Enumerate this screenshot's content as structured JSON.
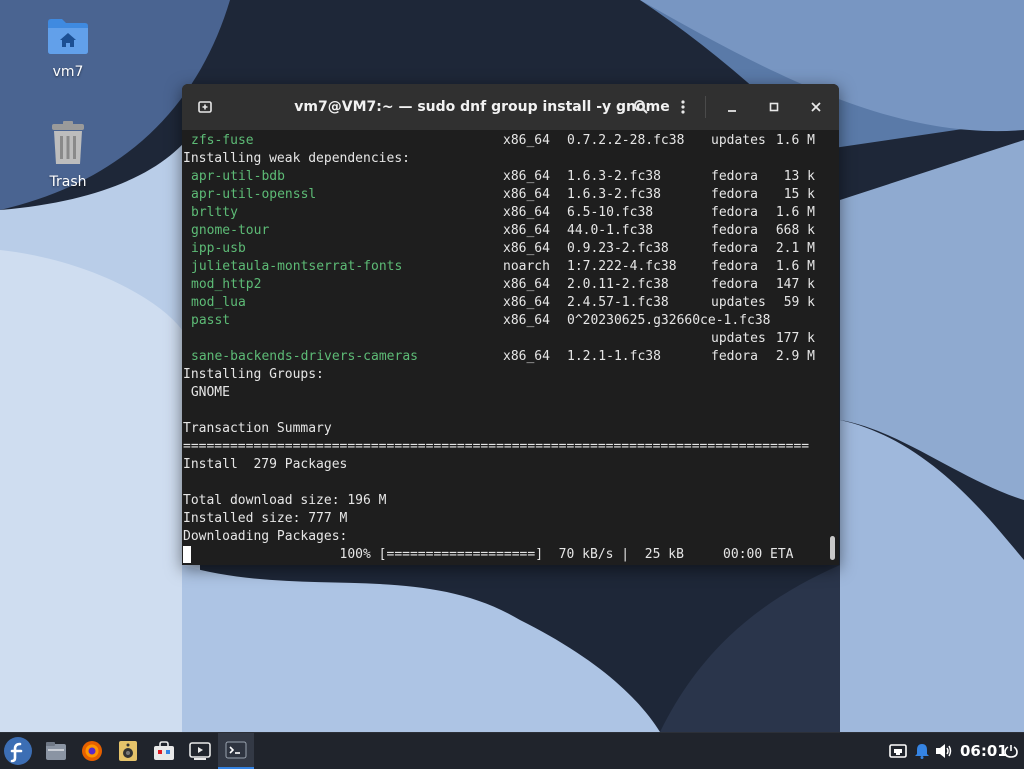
{
  "desktop": {
    "icons": [
      {
        "label": "vm7",
        "icon": "home-folder-icon"
      },
      {
        "label": "Trash",
        "icon": "trash-icon"
      }
    ]
  },
  "terminal": {
    "title": "vm7@VM7:~ — sudo dnf group install -y gnome",
    "lines": [
      {
        "pkg": "zfs-fuse",
        "arch": "x86_64",
        "ver": "0.7.2.2-28.fc38",
        "repo": "updates",
        "size": "1.6 M"
      },
      {
        "text": "Installing weak dependencies:"
      },
      {
        "pkg": "apr-util-bdb",
        "arch": "x86_64",
        "ver": "1.6.3-2.fc38",
        "repo": "fedora",
        "size": "13 k"
      },
      {
        "pkg": "apr-util-openssl",
        "arch": "x86_64",
        "ver": "1.6.3-2.fc38",
        "repo": "fedora",
        "size": "15 k"
      },
      {
        "pkg": "brltty",
        "arch": "x86_64",
        "ver": "6.5-10.fc38",
        "repo": "fedora",
        "size": "1.6 M"
      },
      {
        "pkg": "gnome-tour",
        "arch": "x86_64",
        "ver": "44.0-1.fc38",
        "repo": "fedora",
        "size": "668 k"
      },
      {
        "pkg": "ipp-usb",
        "arch": "x86_64",
        "ver": "0.9.23-2.fc38",
        "repo": "fedora",
        "size": "2.1 M"
      },
      {
        "pkg": "julietaula-montserrat-fonts",
        "arch": "noarch",
        "ver": "1:7.222-4.fc38",
        "repo": "fedora",
        "size": "1.6 M"
      },
      {
        "pkg": "mod_http2",
        "arch": "x86_64",
        "ver": "2.0.11-2.fc38",
        "repo": "fedora",
        "size": "147 k"
      },
      {
        "pkg": "mod_lua",
        "arch": "x86_64",
        "ver": "2.4.57-1.fc38",
        "repo": "updates",
        "size": "59 k"
      },
      {
        "pkg": "passt",
        "arch": "x86_64",
        "ver": "0^20230625.g32660ce-1.fc38"
      },
      {
        "repo": "updates",
        "size": "177 k"
      },
      {
        "pkg": "sane-backends-drivers-cameras",
        "arch": "x86_64",
        "ver": "1.2.1-1.fc38",
        "repo": "fedora",
        "size": "2.9 M"
      },
      {
        "text": "Installing Groups:"
      },
      {
        "text": " GNOME"
      },
      {
        "text": ""
      },
      {
        "text": "Transaction Summary"
      },
      {
        "text": "================================================================================"
      },
      {
        "text": "Install  279 Packages"
      },
      {
        "text": ""
      },
      {
        "text": "Total download size: 196 M"
      },
      {
        "text": "Installed size: 777 M"
      },
      {
        "text": "Downloading Packages:"
      },
      {
        "cursor": true,
        "text": "                    100% [===================]  70 kB/s |  25 kB     00:00 ETA"
      }
    ]
  },
  "taskbar": {
    "clock": "06:01"
  },
  "colors": {
    "terminal_bg": "#1e1e1e",
    "titlebar_bg": "#303030",
    "package_green": "#5dbb76",
    "panel_bg": "#20242c",
    "fedora_blue": "#3c6eb4"
  }
}
